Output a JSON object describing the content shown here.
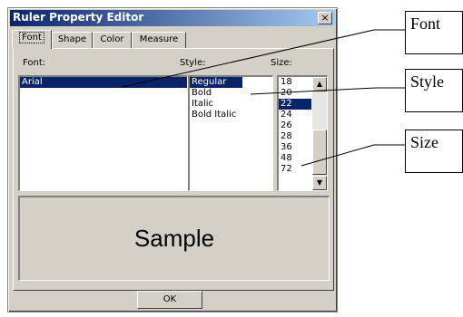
{
  "dialog": {
    "title": "Ruler Property Editor",
    "close_label": "×",
    "tabs": [
      {
        "label": "Font",
        "active": true
      },
      {
        "label": "Shape",
        "active": false
      },
      {
        "label": "Color",
        "active": false
      },
      {
        "label": "Measure",
        "active": false
      }
    ],
    "font_label": "Font:",
    "style_label": "Style:",
    "size_label": "Size:",
    "fonts": [
      "Arial"
    ],
    "selected_font": "Arial",
    "styles": [
      "Regular",
      "Bold",
      "Italic",
      "Bold Italic"
    ],
    "selected_style": "Regular",
    "sizes": [
      "18",
      "20",
      "22",
      "24",
      "26",
      "28",
      "36",
      "48",
      "72"
    ],
    "selected_size": "22",
    "sample_text": "Sample",
    "ok_label": "OK"
  },
  "callouts": {
    "font": "Font",
    "style": "Style",
    "size": "Size"
  },
  "colors": {
    "titlebar_start": "#0a246a",
    "titlebar_end": "#a6caf0",
    "selection": "#0a246a",
    "dialog_face": "#d4d0c8"
  },
  "icons": {
    "close": "close-icon",
    "scroll_up": "arrow-up-icon",
    "scroll_down": "arrow-down-icon"
  }
}
